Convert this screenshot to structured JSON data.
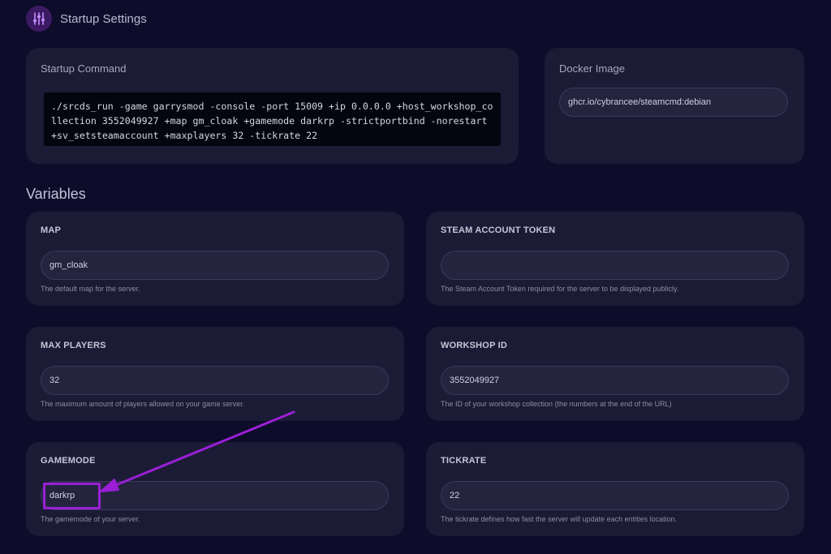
{
  "header": {
    "title": "Startup Settings",
    "icon": "sliders-icon"
  },
  "startup": {
    "title": "Startup Command",
    "command": "./srcds_run -game garrysmod -console -port 15009 +ip 0.0.0.0 +host_workshop_collection 3552049927 +map gm_cloak +gamemode darkrp -strictportbind -norestart +sv_setsteamaccount +maxplayers 32 -tickrate 22"
  },
  "docker": {
    "title": "Docker Image",
    "value": "ghcr.io/cybrancee/steamcmd:debian"
  },
  "variables": {
    "title": "Variables",
    "map": {
      "label": "MAP",
      "value": "gm_cloak",
      "desc": "The default map for the server."
    },
    "steam_token": {
      "label": "STEAM ACCOUNT TOKEN",
      "value": "",
      "desc": "The Steam Account Token required for the server to be displayed publicly."
    },
    "max_players": {
      "label": "MAX PLAYERS",
      "value": "32",
      "desc": "The maximum amount of players allowed on your game server."
    },
    "workshop_id": {
      "label": "WORKSHOP ID",
      "value": "3552049927",
      "desc": "The ID of your workshop collection (the numbers at the end of the URL)"
    },
    "gamemode": {
      "label": "GAMEMODE",
      "value": "darkrp",
      "desc": "The gamemode of your server."
    },
    "tickrate": {
      "label": "TICKRATE",
      "value": "22",
      "desc": "The tickrate defines how fast the server will update each entities location."
    }
  },
  "annotation": {
    "color": "#9a1fd6"
  }
}
